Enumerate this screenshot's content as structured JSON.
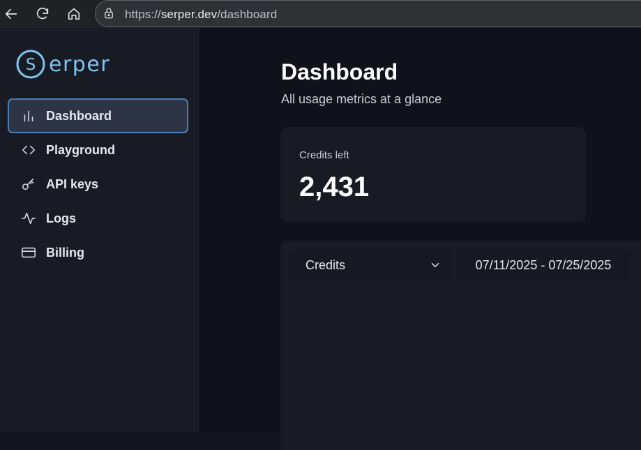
{
  "browser": {
    "url_prefix": "https://",
    "url_host": "serper.dev",
    "url_path": "/dashboard"
  },
  "sidebar": {
    "logo_text": "erper",
    "logo_letter": "S",
    "items": [
      {
        "label": "Dashboard",
        "icon": "bar-chart-icon",
        "active": true
      },
      {
        "label": "Playground",
        "icon": "code-icon",
        "active": false
      },
      {
        "label": "API keys",
        "icon": "key-icon",
        "active": false
      },
      {
        "label": "Logs",
        "icon": "activity-icon",
        "active": false
      },
      {
        "label": "Billing",
        "icon": "credit-card-icon",
        "active": false
      }
    ]
  },
  "main": {
    "title": "Dashboard",
    "subtitle": "All usage metrics at a glance",
    "credits_card": {
      "label": "Credits left",
      "value": "2,431"
    },
    "chart_panel": {
      "metric_select": "Credits",
      "date_range": "07/11/2025 - 07/25/2025"
    }
  },
  "colors": {
    "accent": "#7fc6f0",
    "active_border": "#4b7fb3",
    "sidebar_bg": "#181b24",
    "main_bg": "#0f121a"
  }
}
